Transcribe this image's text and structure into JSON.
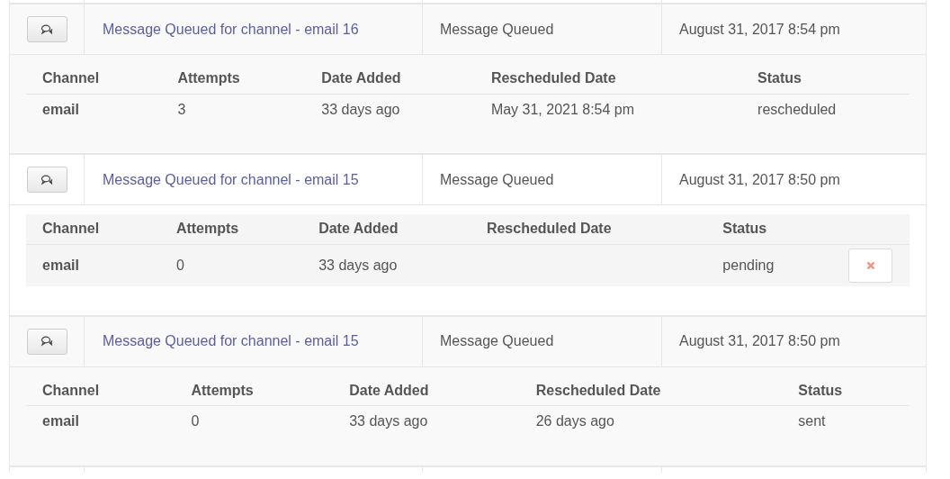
{
  "entries": [
    {
      "title": "Message Queued for channel - email 16",
      "type": "Message Queued",
      "date": "August 31, 2017 8:54 pm",
      "details": {
        "columns": [
          "Channel",
          "Attempts",
          "Date Added",
          "Rescheduled Date",
          "Status"
        ],
        "rows": [
          {
            "cells": [
              "email",
              "3",
              "33 days ago",
              "May 31, 2021 8:54 pm",
              "rescheduled"
            ],
            "delete_button": false
          }
        ]
      }
    },
    {
      "title": "Message Queued for channel - email 15",
      "type": "Message Queued",
      "date": "August 31, 2017 8:50 pm",
      "details": {
        "columns": [
          "Channel",
          "Attempts",
          "Date Added",
          "Rescheduled Date",
          "Status"
        ],
        "rows": [
          {
            "cells": [
              "email",
              "0",
              "33 days ago",
              "",
              "pending"
            ],
            "delete_button": true
          }
        ]
      }
    },
    {
      "title": "Message Queued for channel - email 15",
      "type": "Message Queued",
      "date": "August 31, 2017 8:50 pm",
      "details": {
        "columns": [
          "Channel",
          "Attempts",
          "Date Added",
          "Rescheduled Date",
          "Status"
        ],
        "rows": [
          {
            "cells": [
              "email",
              "0",
              "33 days ago",
              "26 days ago",
              "sent"
            ],
            "delete_button": false
          }
        ]
      }
    }
  ]
}
